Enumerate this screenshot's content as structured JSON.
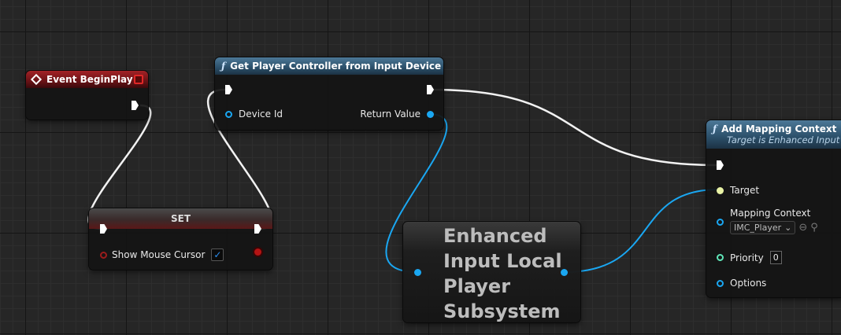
{
  "nodes": {
    "event_begin_play": {
      "title": "Event BeginPlay"
    },
    "get_player_controller": {
      "title": "Get Player Controller from Input Device",
      "device_id_label": "Device Id",
      "return_value_label": "Return Value"
    },
    "set": {
      "title": "SET",
      "show_mouse_cursor_label": "Show Mouse Cursor",
      "show_mouse_cursor_value": "✓"
    },
    "subsystem": {
      "line1": "Enhanced",
      "line2": "Input Local",
      "line3": "Player",
      "line4": "Subsystem"
    },
    "add_mapping_context": {
      "title": "Add Mapping Context",
      "subtitle": "Target is Enhanced Input S",
      "target_label": "Target",
      "mapping_context_label": "Mapping Context",
      "mapping_context_value": "IMC_Player",
      "priority_label": "Priority",
      "priority_value": "0",
      "options_label": "Options"
    }
  },
  "colors": {
    "exec": "#ffffff",
    "object_pin": "#1aa7f2",
    "bool_pin": "#9b1c1c",
    "int_pin": "#5fe6b8",
    "event_header": "#a32226",
    "function_header": "#4c7897"
  },
  "icons": [
    "event-icon",
    "function-icon",
    "dropdown-arrow-icon",
    "use-selected-icon",
    "browse-icon",
    "checkmark-icon"
  ]
}
